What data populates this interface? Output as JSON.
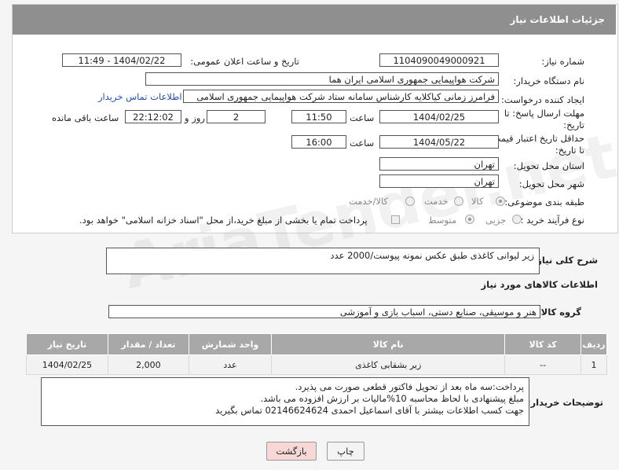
{
  "header": {
    "title": "جزئیات اطلاعات نیاز"
  },
  "fields": {
    "need_number_label": "شماره نیاز:",
    "need_number": "1104090049000921",
    "announce_label": "تاریخ و ساعت اعلان عمومی:",
    "announce_value": "1404/02/22 - 11:49",
    "buyer_label": "نام دستگاه خریدار:",
    "buyer_value": "شرکت هواپیمایی جمهوری اسلامی ایران هما",
    "creator_label": "ایجاد کننده درخواست:",
    "creator_value": "فرامرز زمانی کیاکلایه کارشناس سامانه ستاد شرکت هواپیمایی جمهوری اسلامی",
    "contact_link": "اطلاعات تماس خریدار",
    "deadline_label_1": "مهلت ارسال پاسخ: تا",
    "deadline_label_2": "تاریخ:",
    "deadline_date": "1404/02/25",
    "time_label": "ساعت",
    "deadline_time": "11:50",
    "days_value": "2",
    "days_label": "روز و",
    "remaining_value": "22:12:02",
    "remaining_label": "ساعت باقی مانده",
    "validity_label_1": "حداقل تاریخ اعتبار قیمت:",
    "validity_label_2": "تا تاریخ:",
    "validity_date": "1404/05/22",
    "validity_time_label": "ساعت",
    "validity_time": "16:00",
    "province_label": "استان محل تحویل:",
    "province_value": "تهران",
    "city_label": "شهر محل تحویل:",
    "city_value": "تهران",
    "category_label": "طبقه بندی موضوعی:",
    "category_options": [
      "کالا",
      "خدمت",
      "کالا/خدمت"
    ],
    "process_label": "نوع فرآیند خرید :",
    "process_options": [
      "جزیی",
      "متوسط"
    ],
    "payment_note": "پرداخت تمام یا بخشی از مبلغ خرید،از محل \"اسناد خزانه اسلامی\" خواهد بود."
  },
  "description": {
    "label": "شرح کلی نیاز:",
    "value": "زیر لیوانی کاغذی طبق عکس نمونه پیوست/2000 عدد"
  },
  "goods_section": {
    "title": "اطلاعات کالاهای مورد نیاز",
    "group_label": "گروه کالا:",
    "group_value": "هنر و موسیقی، صنایع دستی، اسباب بازی و آموزشی"
  },
  "table": {
    "headers": [
      "ردیف",
      "کد کالا",
      "نام کالا",
      "واحد شمارش",
      "تعداد / مقدار",
      "تاریخ نیاز"
    ],
    "rows": [
      [
        "1",
        "--",
        "زیر بشقابی کاغذی",
        "عدد",
        "2,000",
        "1404/02/25"
      ]
    ]
  },
  "buyer_notes": {
    "label": "توضیحات خریدار:",
    "lines": [
      "پرداخت:سه ماه بعد از تحویل فاکتور قطعی صورت می پذیرد.",
      "مبلغ پیشنهادی با لحاظ محاسبه 10%مالیات بر ارزش افزوده می باشد.",
      "جهت کسب اطلاعات بیشتر با آقای اسماعیل احمدی 02146624624 تماس بگیرید"
    ]
  },
  "buttons": {
    "print": "چاپ",
    "back": "بازگشت"
  },
  "watermark": "AriaTender.net",
  "colors": {
    "header_bg": "#8f8f8f",
    "table_header_bg": "#a8a8a8",
    "back_button_bg": "#f8d7d7",
    "link": "#1f4fb4"
  }
}
